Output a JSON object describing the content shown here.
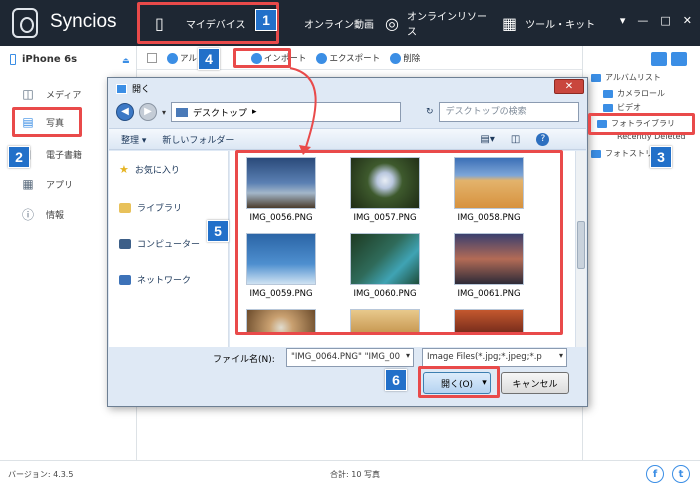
{
  "app": {
    "name": "Syncios",
    "version_label": "バージョン: 4.3.5",
    "total_label": "合計: 10 写真"
  },
  "nav": [
    {
      "label": "マイデバイス",
      "icon": "phone-icon"
    },
    {
      "label": "オンライン動画",
      "icon": "play-icon"
    },
    {
      "label": "オンラインリソース",
      "icon": "globe-icon"
    },
    {
      "label": "ツール・キット",
      "icon": "grid-icon"
    }
  ],
  "window_controls": [
    "▾",
    "—",
    "□",
    "✕"
  ],
  "sidebar": {
    "device": "iPhone 6s",
    "items": [
      {
        "label": "メディア",
        "icon": "tv-icon"
      },
      {
        "label": "写真",
        "icon": "photo-icon"
      },
      {
        "label": "電子書籍",
        "icon": "book-icon"
      },
      {
        "label": "アプリ",
        "icon": "apps-icon"
      },
      {
        "label": "情報",
        "icon": "info-icon"
      }
    ]
  },
  "toolbar": {
    "add_label": "アル",
    "import_label": "インポート",
    "export_label": "エクスポート",
    "delete_label": "削除"
  },
  "albums": {
    "header": "アルバムリスト",
    "items": [
      "カメラロール",
      "ビデオ",
      "フォトライブラリ",
      "Recently Deleted"
    ],
    "stream": "フォトストリーム"
  },
  "dialog": {
    "title": "開く",
    "address": "デスクトップ",
    "search_placeholder": "デスクトップの検索",
    "organize": "整理 ▾",
    "new_folder": "新しいフォルダー",
    "nav_items": [
      {
        "label": "お気に入り"
      },
      {
        "label": "ライブラリ"
      },
      {
        "label": "コンピューター"
      },
      {
        "label": "ネットワーク"
      }
    ],
    "files": [
      "IMG_0056.PNG",
      "IMG_0057.PNG",
      "IMG_0058.PNG",
      "IMG_0059.PNG",
      "IMG_0060.PNG",
      "IMG_0061.PNG",
      "",
      "",
      ""
    ],
    "filename_label": "ファイル名(N):",
    "filename_value": "\"IMG_0064.PNG\" \"IMG_00",
    "filetype_value": "Image Files(*.jpg;*.jpeg;*.p",
    "open_button": "開く(O)",
    "cancel_button": "キャンセル"
  },
  "callouts": [
    "1",
    "2",
    "3",
    "4",
    "5",
    "6"
  ],
  "colors": {
    "topbar": "#1e2733",
    "accent": "#3b8ee5",
    "highlight": "#e94a4a",
    "badge": "#2270c9"
  }
}
